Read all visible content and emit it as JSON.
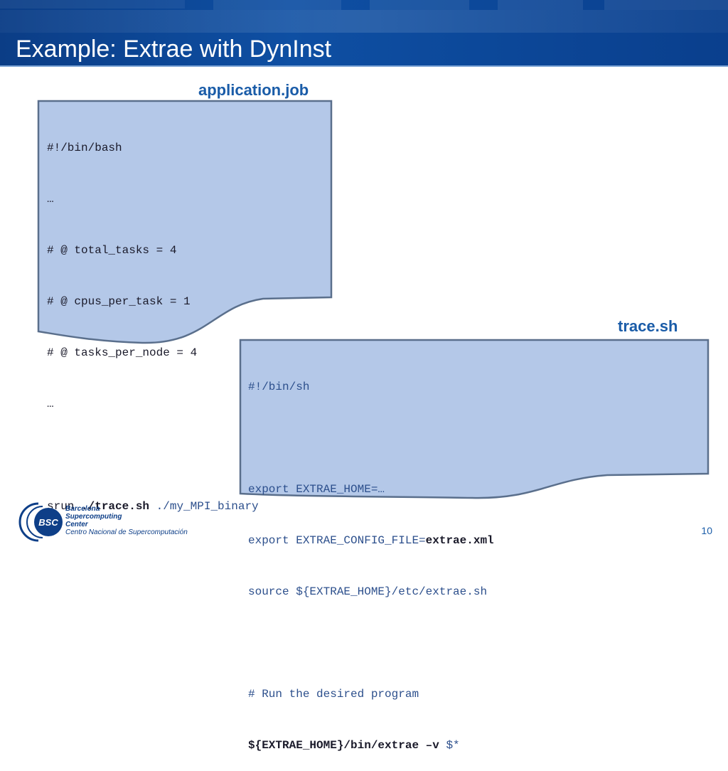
{
  "slide": {
    "title": "Example: Extrae with DynInst",
    "page_number": "10"
  },
  "application_job": {
    "label": "application.job",
    "lines": {
      "l1": "#!/bin/bash",
      "l2": "…",
      "l3": "# @ total_tasks = 4",
      "l4": "# @ cpus_per_task = 1",
      "l5": "# @ tasks_per_node = 4",
      "l6": "…",
      "srun_prefix": "srun ",
      "srun_trace": "./trace.sh",
      "srun_binary": " ./my_MPI_binary"
    }
  },
  "trace_sh": {
    "label": "trace.sh",
    "lines": {
      "l1": "#!/bin/sh",
      "l2": "export EXTRAE_HOME=…",
      "l3_prefix": "export EXTRAE_CONFIG_FILE=",
      "l3_bold": "extrae.xml",
      "l4": "source ${EXTRAE_HOME}/etc/extrae.sh",
      "l5": "# Run the desired program",
      "l6_bold": "${EXTRAE_HOME}/bin/extrae –v",
      "l6_suffix": " $*"
    }
  },
  "logo": {
    "emblem_text": "BSC",
    "line1": "Barcelona",
    "line2": "Supercomputing",
    "line3": "Center",
    "line4": "Centro Nacional de Supercomputación"
  },
  "colors": {
    "header_blue": "#0e4fa3",
    "box_fill": "#b4c8e8",
    "box_border": "#5a6f8c",
    "label_blue": "#1a5ca8"
  }
}
